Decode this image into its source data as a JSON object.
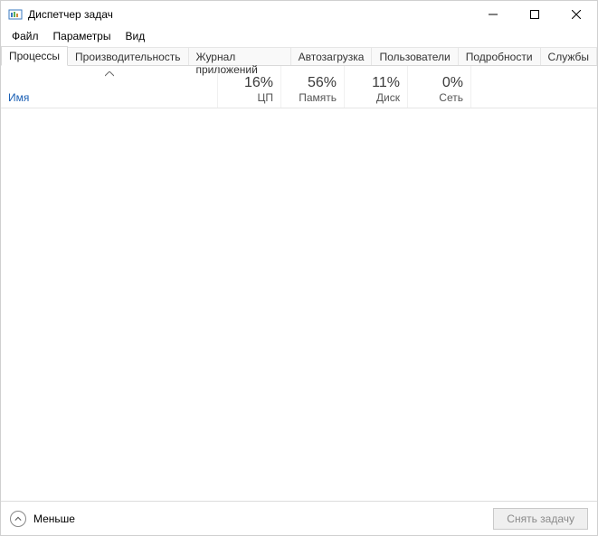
{
  "window": {
    "title": "Диспетчер задач"
  },
  "menu": {
    "file": "Файл",
    "options": "Параметры",
    "view": "Вид"
  },
  "tabs": {
    "processes": "Процессы",
    "performance": "Производительность",
    "app_history": "Журнал приложений",
    "startup": "Автозагрузка",
    "users": "Пользователи",
    "details": "Подробности",
    "services": "Службы"
  },
  "columns": {
    "name": "Имя",
    "cpu": {
      "pct": "16%",
      "label": "ЦП"
    },
    "memory": {
      "pct": "56%",
      "label": "Память"
    },
    "disk": {
      "pct": "11%",
      "label": "Диск"
    },
    "network": {
      "pct": "0%",
      "label": "Сеть"
    }
  },
  "footer": {
    "fewer": "Меньше",
    "end_task": "Снять задачу"
  }
}
